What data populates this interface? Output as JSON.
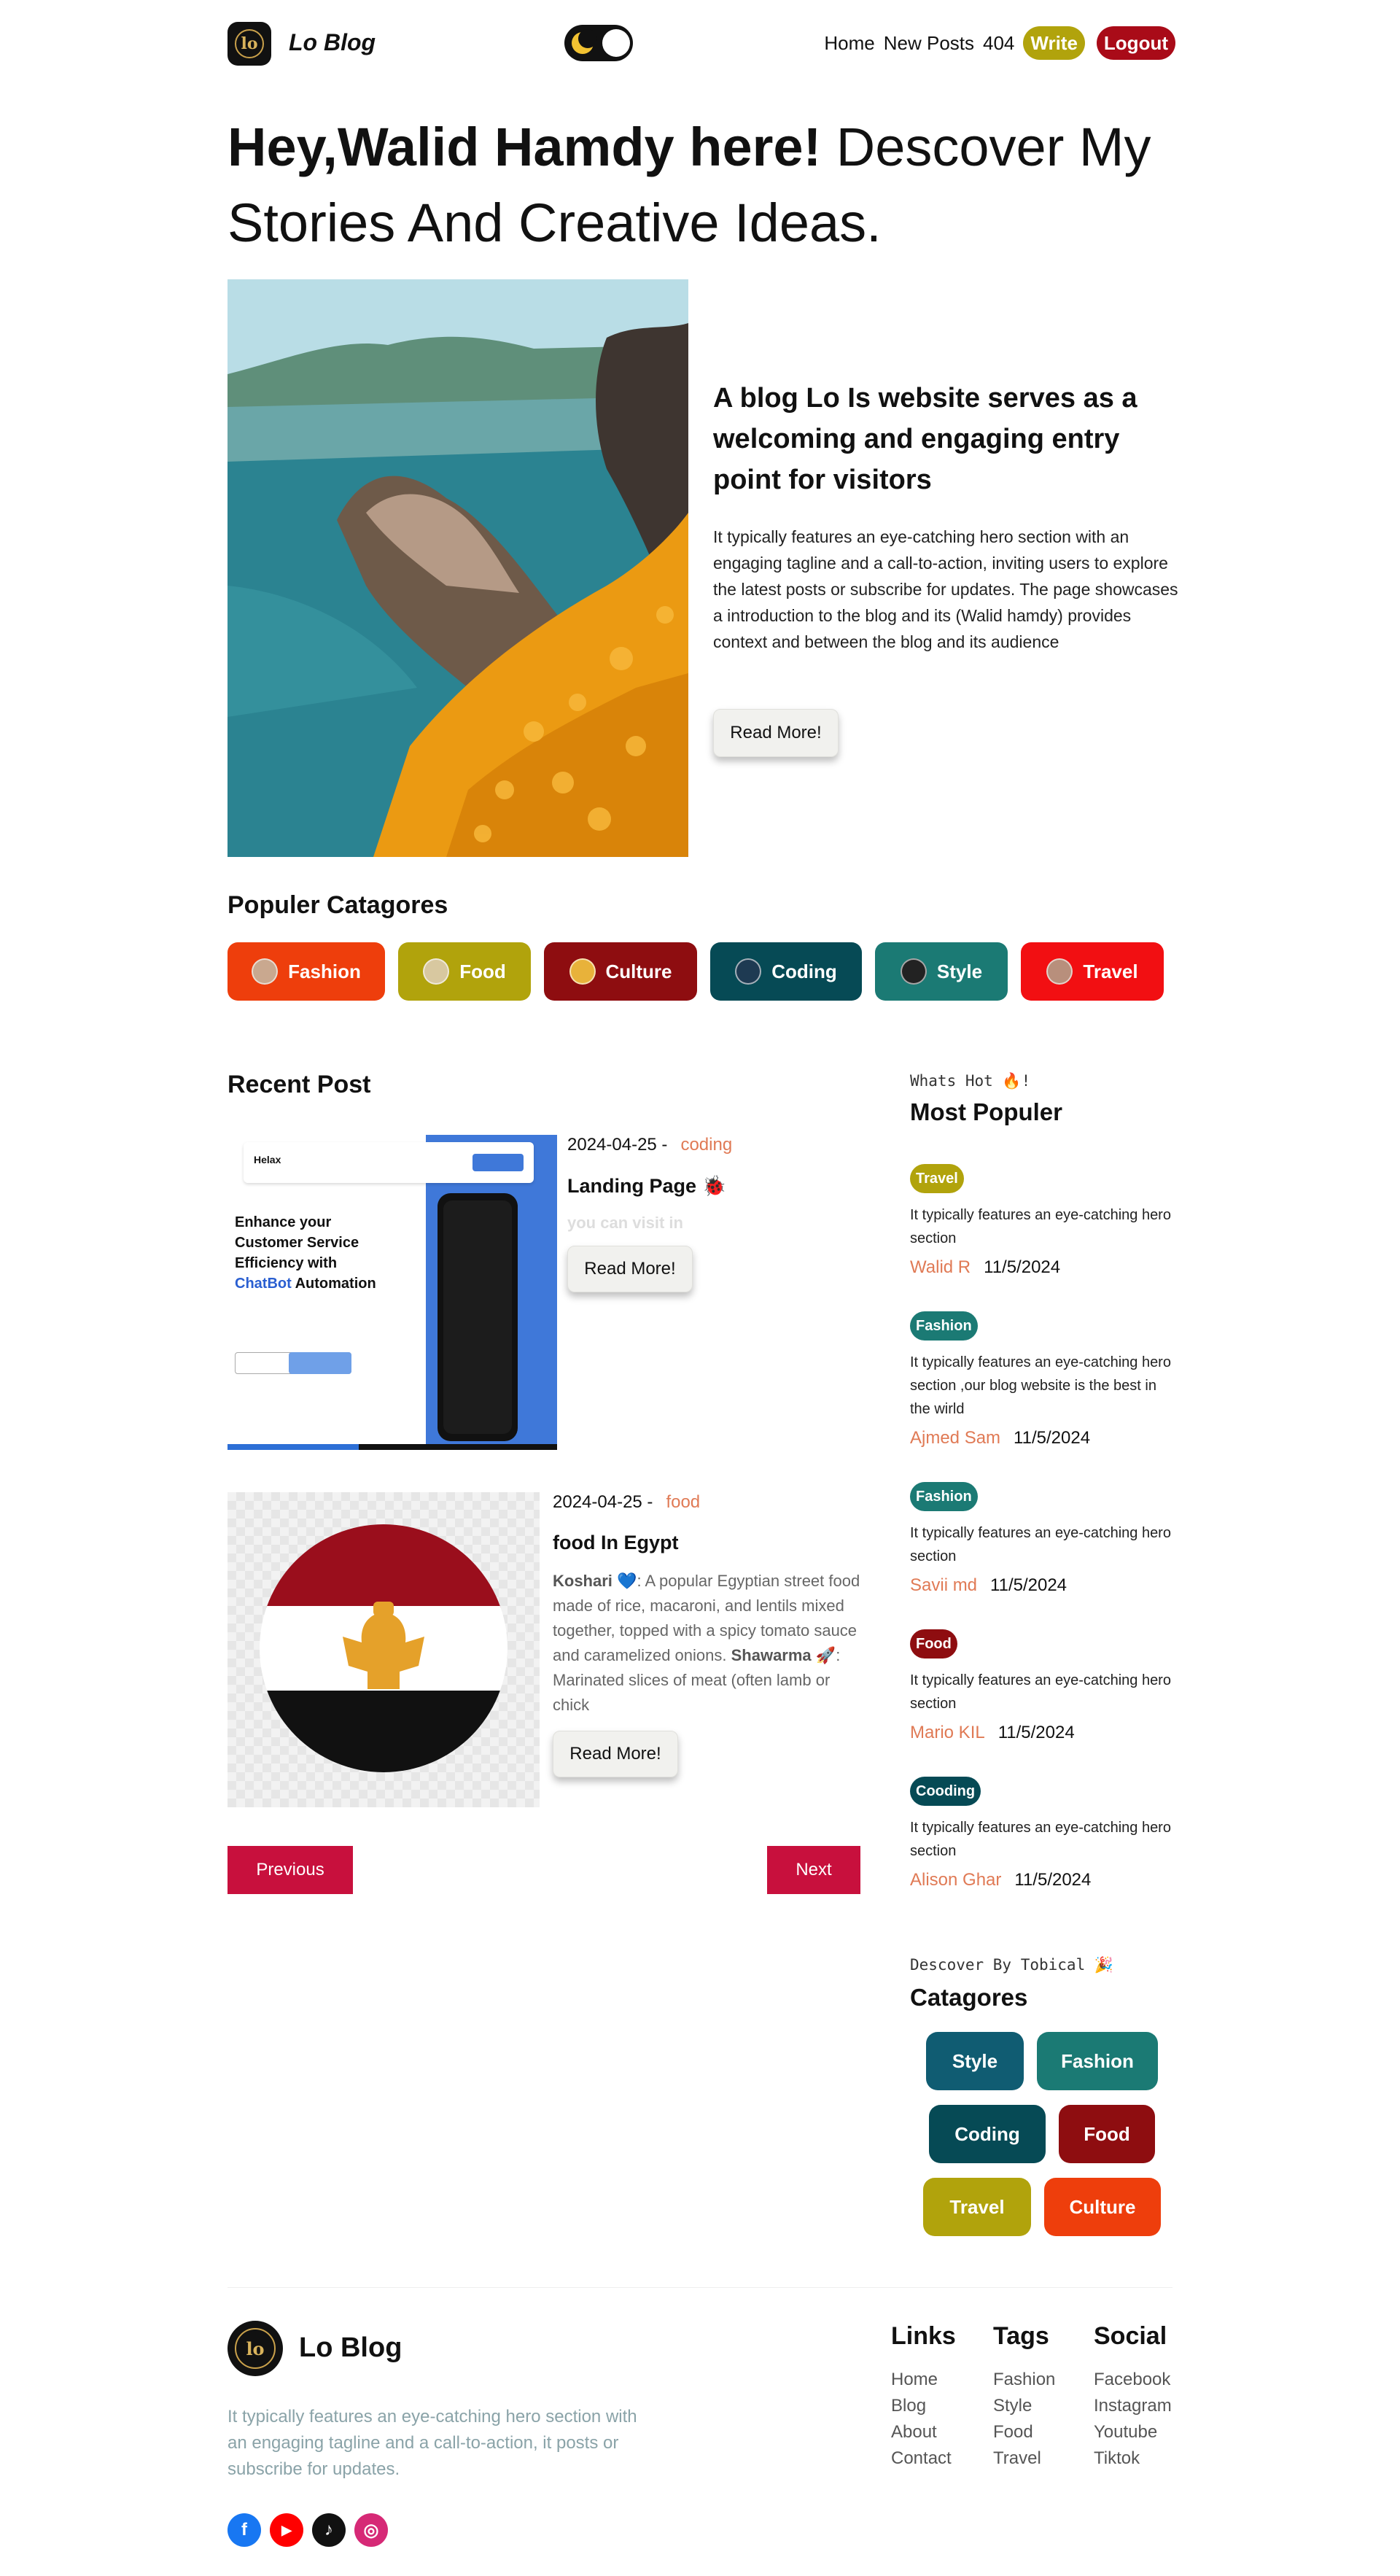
{
  "nav": {
    "brand": "Lo Blog",
    "logo_monogram": "lo",
    "links": [
      "Home",
      "New Posts",
      "404"
    ],
    "write_label": "Write",
    "logout_label": "Logout"
  },
  "hero": {
    "title_bold": "Hey,Walid Hamdy here!",
    "title_rest": "Descover My Stories And Creative Ideas.",
    "heading_prefix": "A",
    "heading_bold": "blog Lo",
    "heading_rest": "Is website serves as a welcoming and engaging entry point for visitors",
    "description": "It typically features an eye-catching hero section with an engaging tagline and a call-to-action, inviting users to explore the latest posts or subscribe for updates. The page showcases a introduction to the blog and its (Walid hamdy) provides context and between the blog and its audience",
    "read_more": "Read More!"
  },
  "popular_categories": {
    "title": "Populer Catagores",
    "items": [
      {
        "label": "Fashion",
        "color": "#ee3e0c"
      },
      {
        "label": "Food",
        "color": "#b1a30c"
      },
      {
        "label": "Culture",
        "color": "#8e0d10"
      },
      {
        "label": "Coding",
        "color": "#064a55"
      },
      {
        "label": "Style",
        "color": "#1b7a74"
      },
      {
        "label": "Travel",
        "color": "#f20f12"
      }
    ]
  },
  "recent": {
    "title": "Recent Post",
    "posts": [
      {
        "date": "2024-04-25 -",
        "category": "coding",
        "title": "Landing Page 🐞",
        "subtitle": "you can visit in",
        "read_more": "Read More!",
        "preview": {
          "brand": "Helax",
          "headline_1": "Enhance your",
          "headline_2": "Customer Service",
          "headline_3": "Efficiency with",
          "headline_accent": "ChatBot",
          "headline_end": "Automation"
        }
      },
      {
        "date": "2024-04-25 -",
        "category": "food",
        "title": "food In Egypt",
        "desc_term1": "Koshari",
        "desc_text1": "💙: A popular Egyptian street food made of rice, macaroni, and lentils mixed together, topped with a spicy tomato sauce and caramelized onions.",
        "desc_term2": "Shawarma",
        "desc_text2": "🚀: Marinated slices of meat (often lamb or chick",
        "read_more": "Read More!"
      }
    ],
    "previous_label": "Previous",
    "next_label": "Next"
  },
  "sidebar": {
    "hot_kicker": "Whats Hot 🔥!",
    "hot_title": "Most Populer",
    "hot_items": [
      {
        "tag": "Travel",
        "color": "#b1a30c",
        "text": "It typically features an eye-catching hero section",
        "author": "Walid R",
        "date": "11/5/2024"
      },
      {
        "tag": "Fashion",
        "color": "#1b7a74",
        "text": "It typically features an eye-catching hero section ,our blog website is the best in the wirld",
        "author": "Ajmed Sam",
        "date": "11/5/2024"
      },
      {
        "tag": "Fashion",
        "color": "#1b7a74",
        "text": "It typically features an eye-catching hero section",
        "author": "Savii md",
        "date": "11/5/2024"
      },
      {
        "tag": "Food",
        "color": "#8e0d10",
        "text": "It typically features an eye-catching hero section",
        "author": "Mario KIL",
        "date": "11/5/2024"
      },
      {
        "tag": "Cooding",
        "color": "#064a55",
        "text": "It typically features an eye-catching hero section",
        "author": "Alison Ghar",
        "date": "11/5/2024"
      }
    ],
    "topic_kicker": "Descover By Tobical 🎉",
    "topic_title": "Catagores",
    "topics": [
      {
        "label": "Style",
        "color": "#105c72"
      },
      {
        "label": "Fashion",
        "color": "#1b7a74"
      },
      {
        "label": "Coding",
        "color": "#064a55"
      },
      {
        "label": "Food",
        "color": "#8e0d10"
      },
      {
        "label": "Travel",
        "color": "#b1a30c"
      },
      {
        "label": "Culture",
        "color": "#ee3e0c"
      }
    ]
  },
  "footer": {
    "brand": "Lo Blog",
    "description": "It typically features an eye-catching hero section with an engaging tagline and a call-to-action, it posts or subscribe for updates.",
    "links_title": "Links",
    "links": [
      "Home",
      "Blog",
      "About",
      "Contact"
    ],
    "tags_title": "Tags",
    "tags": [
      "Fashion",
      "Style",
      "Food",
      "Travel"
    ],
    "social_title": "Social",
    "social": [
      "Facebook",
      "Instagram",
      "Youtube",
      "Tiktok"
    ],
    "social_icons": [
      {
        "name": "facebook-icon",
        "glyph": "f",
        "color": "#1877f2"
      },
      {
        "name": "youtube-icon",
        "glyph": "▶",
        "color": "#ff0000"
      },
      {
        "name": "tiktok-icon",
        "glyph": "♪",
        "color": "#111111"
      },
      {
        "name": "instagram-icon",
        "glyph": "◎",
        "color": "#d62976"
      }
    ]
  }
}
